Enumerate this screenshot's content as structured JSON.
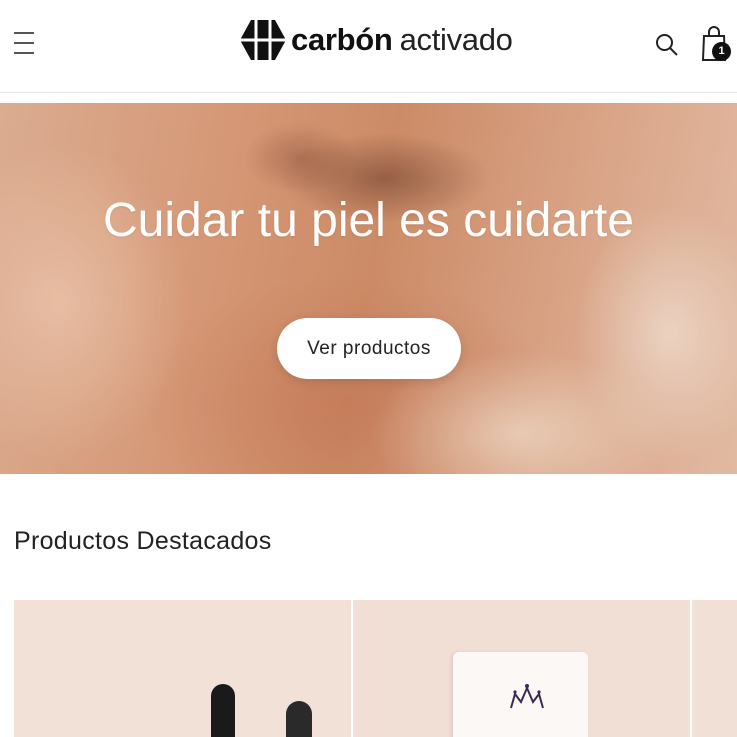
{
  "header": {
    "logo": {
      "bold": "carbón",
      "light": "activado"
    },
    "cart_count": "1",
    "icons": {
      "menu": "menu-icon",
      "search": "search-icon",
      "cart": "shopping-bag-icon"
    }
  },
  "hero": {
    "title": "Cuidar tu piel es cuidarte",
    "button_label": "Ver productos"
  },
  "featured": {
    "title": "Productos Destacados"
  },
  "colors": {
    "text": "#222222",
    "card_bg": "#f1e1d6",
    "badge_bg": "#111111"
  }
}
